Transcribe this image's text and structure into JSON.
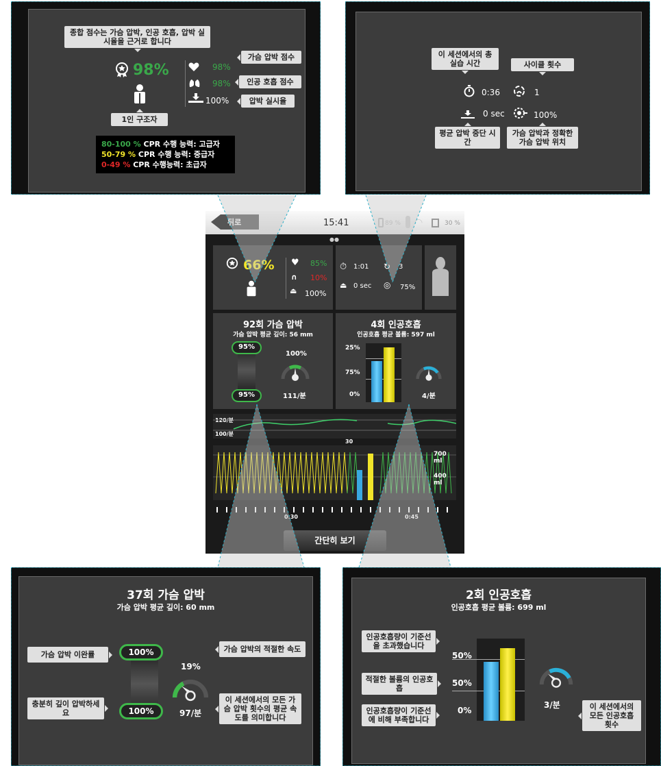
{
  "top_left": {
    "tip_overall": "종합 점수는 가슴 압박, 인공 호흡, 압박 실시율을 근거로 합니다",
    "score": "98%",
    "compression_score": "98%",
    "ventilation_score": "98%",
    "flow_fraction": "100%",
    "tip_compression": "가슴 압박 점수",
    "tip_ventilation": "인공 호흡 점수",
    "tip_flow": "압박 실시율",
    "tip_rescuer": "1인 구조자",
    "legend": [
      {
        "range": "80-100 %",
        "label": "CPR 수행 능력: 고급자",
        "color": "#3aa84a"
      },
      {
        "range": "50-79 %",
        "label": "CPR 수행 능력: 중급자",
        "color": "#f2e52a"
      },
      {
        "range": "0-49 %",
        "label": "CPR 수행능력: 초급자",
        "color": "#e02828"
      }
    ]
  },
  "top_right": {
    "tip_time": "이 세션에서의 총 실습 시간",
    "tip_cycles": "사이클 횟수",
    "time": "0:36",
    "cycles": "1",
    "pause": "0 sec",
    "hand_position": "100%",
    "tip_pause": "평균 압박 중단 시간",
    "tip_hand": "가슴 압박과 정확한 가슴 압박 위치"
  },
  "phone": {
    "back_label": "뒤로",
    "clock": "15:41",
    "status_pct1": "89 %",
    "status_pct2": "30 %",
    "score": "66%",
    "comp_score": "85%",
    "vent_score": "10%",
    "flow": "100%",
    "time": "1:01",
    "cycles": "3",
    "pause": "0 sec",
    "hand": "75%",
    "comp_title": "92회 가슴 압박",
    "comp_sub": "가슴 압박 평균 깊이: 56 mm",
    "comp_top_pill": "95%",
    "comp_bottom_pill": "95%",
    "comp_rate_pct": "100%",
    "comp_rate": "111/분",
    "vent_title": "4회 인공호흡",
    "vent_sub": "인공호흡 평균 볼륨: 597 ml",
    "vent_labels": [
      "25%",
      "75%",
      "0%"
    ],
    "vent_rate": "4/분",
    "wave_label_120": "120/분",
    "wave_label_100": "100/분",
    "count_label": "30",
    "vol_700": "700 ml",
    "vol_400": "400 ml",
    "tick_030": "0:30",
    "tick_045": "0:45",
    "summary_button": "간단히 보기"
  },
  "bottom_left": {
    "title": "37회 가슴 압박",
    "subtitle": "가슴 압박 평균 깊이: 60 mm",
    "tip_recoil": "가슴 압박 이완률",
    "tip_depth": "충분히 깊이 압박하세요",
    "top_pill": "100%",
    "bottom_pill": "100%",
    "rate_pct": "19%",
    "rate": "97/분",
    "tip_rate_ok": "가슴 압박의 적절한 속도",
    "tip_rate_avg": "이 세션에서의 모든 가슴 압박 횟수의 평균 속도를 의미합니다"
  },
  "bottom_right": {
    "title": "2회 인공호흡",
    "subtitle": "인공호흡 평균 볼륨: 699 ml",
    "tip_over": "인공호흡량이 기준선을 초과했습니다",
    "tip_ok": "적절한 볼륨의 인공호흡",
    "tip_under": "인공호흡량이 기준선에 비해 부족합니다",
    "labels": [
      "50%",
      "50%",
      "0%"
    ],
    "rate": "3/분",
    "tip_rate": "이 세션에서의 모든 인공호흡 횟수"
  }
}
